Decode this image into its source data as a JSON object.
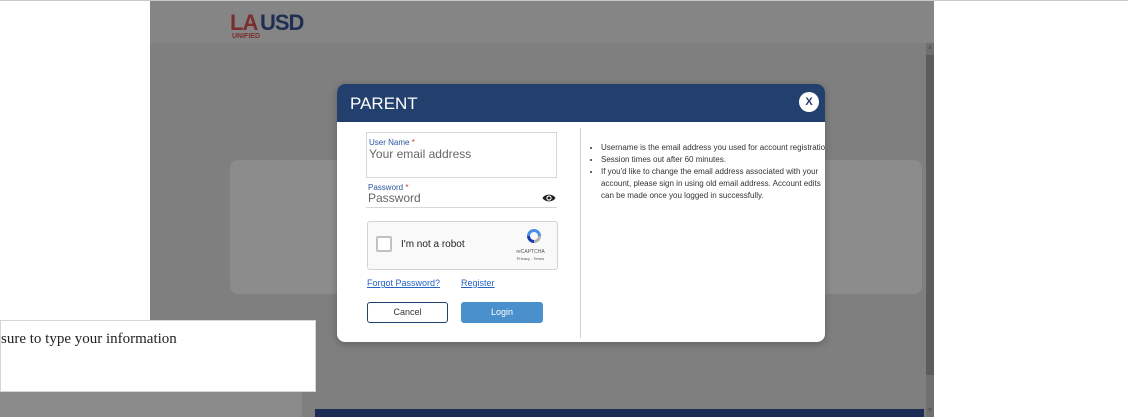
{
  "background": {
    "logo": {
      "la": "LA",
      "usd": "USD",
      "unified": "UNIFIED"
    },
    "scroll_up": "▲",
    "scroll_down": "▼"
  },
  "popup": {
    "text": "sure to type your information"
  },
  "modal": {
    "title": "PARENT",
    "close_label": "X",
    "username": {
      "label": "User Name",
      "required_mark": "*",
      "placeholder": "Your email address"
    },
    "password": {
      "label": "Password",
      "required_mark": "*",
      "placeholder": "Password"
    },
    "captcha": {
      "label": "I'm not a robot",
      "brand": "reCAPTCHA",
      "terms": "Privacy - Terms"
    },
    "links": {
      "forgot": "Forgot Password?",
      "register": "Register"
    },
    "buttons": {
      "cancel": "Cancel",
      "login": "Login"
    },
    "info_items": [
      "Username is the email address you used for account registration.",
      "Session times out after 60 minutes.",
      "If you'd like to change the email address associated with your account, please sign in using old email address. Account edits can be made once you logged in successfully."
    ]
  },
  "colors": {
    "modal_header": "#223f6e",
    "login_button": "#4a90cc",
    "link": "#2563c4",
    "overlay": "#7f7f7f"
  }
}
